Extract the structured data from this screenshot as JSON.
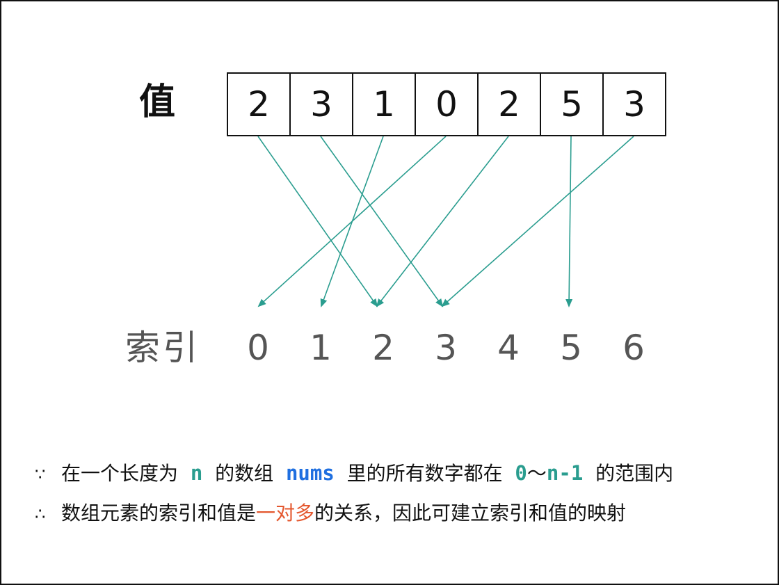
{
  "value_label": "值",
  "index_label": "索引",
  "values": [
    "2",
    "3",
    "1",
    "0",
    "2",
    "5",
    "3"
  ],
  "indices": [
    "0",
    "1",
    "2",
    "3",
    "4",
    "5",
    "6"
  ],
  "arrow_color": "#2a9d8f",
  "notes": {
    "line1": {
      "symbol": "∵",
      "p1": "在一个长度为",
      "n": "n",
      "p2": "的数组",
      "nums": "nums",
      "p3": "里的所有数字都在",
      "zero": "0",
      "tilde": "～",
      "nminus1": "n-1",
      "p4": "的范围内"
    },
    "line2": {
      "symbol": "∴",
      "p1": "数组元素的索引和值是",
      "highlight": "一对多",
      "p2": "的关系，因此可建立索引和值的映射"
    }
  },
  "colors": {
    "teal": "#2a9d8f",
    "blue": "#1f6fe0",
    "red": "#e4572e"
  }
}
